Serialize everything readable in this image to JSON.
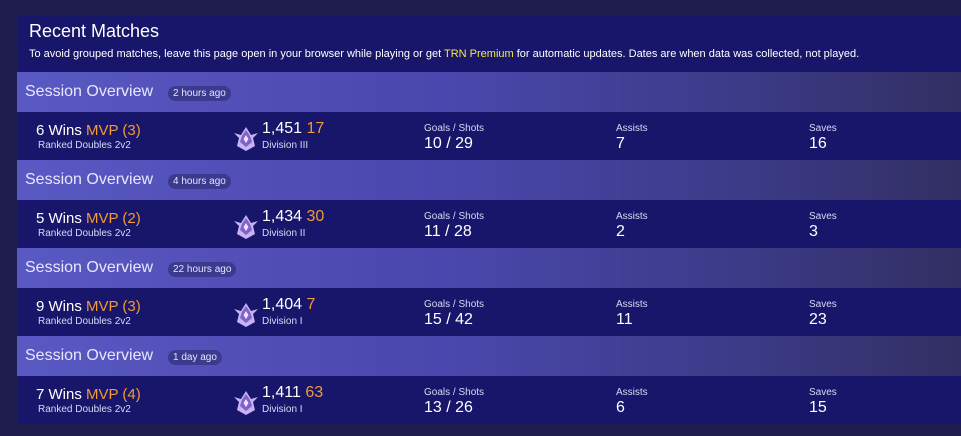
{
  "title": "Recent Matches",
  "notice": {
    "before": "To avoid grouped matches, leave this page open in your browser while playing or get ",
    "link": "TRN Premium",
    "after": " for automatic updates. Dates are when data was collected, not played."
  },
  "column_labels": {
    "goals_shots": "Goals / Shots",
    "assists": "Assists",
    "saves": "Saves"
  },
  "colors": {
    "background": "#1f1d4d",
    "panel": "#17166a",
    "header_gradient_start": "#5a58c2",
    "accent_orange": "#f09a3c",
    "premium_yellow": "#f5ea3a"
  },
  "sessions": [
    {
      "header_label": "Session Overview",
      "time_ago": "2 hours ago",
      "wins": "6 Wins",
      "mvp": "MVP (3)",
      "playlist": "Ranked Doubles 2v2",
      "rank_icon": "champion-rank-icon",
      "mmr": "1,451",
      "mmr_delta": "17",
      "division": "Division III",
      "goals_shots": "10 / 29",
      "assists": "7",
      "saves": "16"
    },
    {
      "header_label": "Session Overview",
      "time_ago": "4 hours ago",
      "wins": "5 Wins",
      "mvp": "MVP (2)",
      "playlist": "Ranked Doubles 2v2",
      "rank_icon": "champion-rank-icon",
      "mmr": "1,434",
      "mmr_delta": "30",
      "division": "Division II",
      "goals_shots": "11 / 28",
      "assists": "2",
      "saves": "3"
    },
    {
      "header_label": "Session Overview",
      "time_ago": "22 hours ago",
      "wins": "9 Wins",
      "mvp": "MVP (3)",
      "playlist": "Ranked Doubles 2v2",
      "rank_icon": "champion-rank-icon",
      "mmr": "1,404",
      "mmr_delta": "7",
      "division": "Division I",
      "goals_shots": "15 / 42",
      "assists": "11",
      "saves": "23"
    },
    {
      "header_label": "Session Overview",
      "time_ago": "1 day ago",
      "wins": "7 Wins",
      "mvp": "MVP (4)",
      "playlist": "Ranked Doubles 2v2",
      "rank_icon": "champion-rank-icon",
      "mmr": "1,411",
      "mmr_delta": "63",
      "division": "Division I",
      "goals_shots": "13 / 26",
      "assists": "6",
      "saves": "15"
    }
  ]
}
